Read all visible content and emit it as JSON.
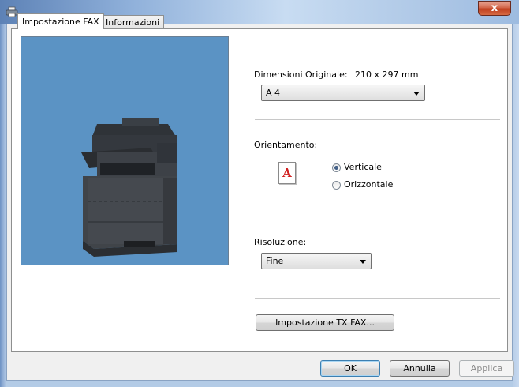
{
  "window": {
    "icon": "printer-icon",
    "close_glyph": "x"
  },
  "tabs": [
    {
      "label": "Impostazione FAX",
      "active": true
    },
    {
      "label": "Informazioni",
      "active": false
    }
  ],
  "preview": {
    "image": "multifunction-printer"
  },
  "original_size": {
    "label": "Dimensioni Originale:",
    "dimensions": "210 x 297 mm",
    "selected": "A 4"
  },
  "orientation": {
    "label": "Orientamento:",
    "icon_letter": "A",
    "options": [
      {
        "label": "Verticale",
        "checked": true
      },
      {
        "label": "Orizzontale",
        "checked": false
      }
    ]
  },
  "resolution": {
    "label": "Risoluzione:",
    "selected": "Fine"
  },
  "tx_button": {
    "label": "Impostazione TX FAX..."
  },
  "footer": {
    "ok": "OK",
    "cancel": "Annulla",
    "apply": "Applica"
  },
  "colors": {
    "preview_bg": "#5b93c4",
    "orient_letter": "#d11f1f"
  }
}
